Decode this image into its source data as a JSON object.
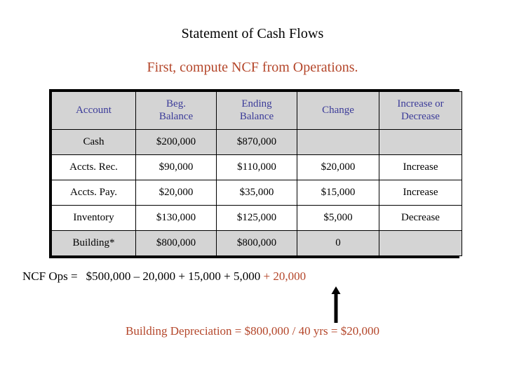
{
  "slide": {
    "title": "Statement of Cash Flows",
    "subtitle": "First, compute NCF from Operations."
  },
  "colors": {
    "accent_red": "#b4462a",
    "header_blue": "#3b3b99",
    "shade_gray": "#d4d4d4",
    "border_black": "#000000",
    "background": "#ffffff"
  },
  "table": {
    "headers": [
      "Account",
      "Beg. Balance",
      "Ending Balance",
      "Change",
      "Increase or Decrease"
    ],
    "headers_lines": [
      [
        "Account"
      ],
      [
        "Beg.",
        "Balance"
      ],
      [
        "Ending",
        "Balance"
      ],
      [
        "Change"
      ],
      [
        "Increase or",
        "Decrease"
      ]
    ],
    "rows": [
      {
        "shaded": true,
        "account": "Cash",
        "beg_balance": "$200,000",
        "ending_balance": "$870,000",
        "change": "",
        "increase_or_decrease": ""
      },
      {
        "shaded": false,
        "account": "Accts. Rec.",
        "beg_balance": "$90,000",
        "ending_balance": "$110,000",
        "change": "$20,000",
        "increase_or_decrease": "Increase"
      },
      {
        "shaded": false,
        "account": "Accts. Pay.",
        "beg_balance": "$20,000",
        "ending_balance": "$35,000",
        "change": "$15,000",
        "increase_or_decrease": "Increase"
      },
      {
        "shaded": false,
        "account": "Inventory",
        "beg_balance": "$130,000",
        "ending_balance": "$125,000",
        "change": "$5,000",
        "increase_or_decrease": "Decrease"
      },
      {
        "shaded": true,
        "account": "Building*",
        "beg_balance": "$800,000",
        "ending_balance": "$800,000",
        "change": "0",
        "increase_or_decrease": ""
      }
    ]
  },
  "ncf": {
    "label": "NCF Ops =",
    "expression_black": "$500,000 – 20,000 + 15,000 + 5,000 ",
    "expression_highlight": "+ 20,000"
  },
  "annotation": {
    "arrow_icon": "up-arrow-icon",
    "footnote": "Building Depreciation = $800,000 / 40 yrs = $20,000"
  }
}
